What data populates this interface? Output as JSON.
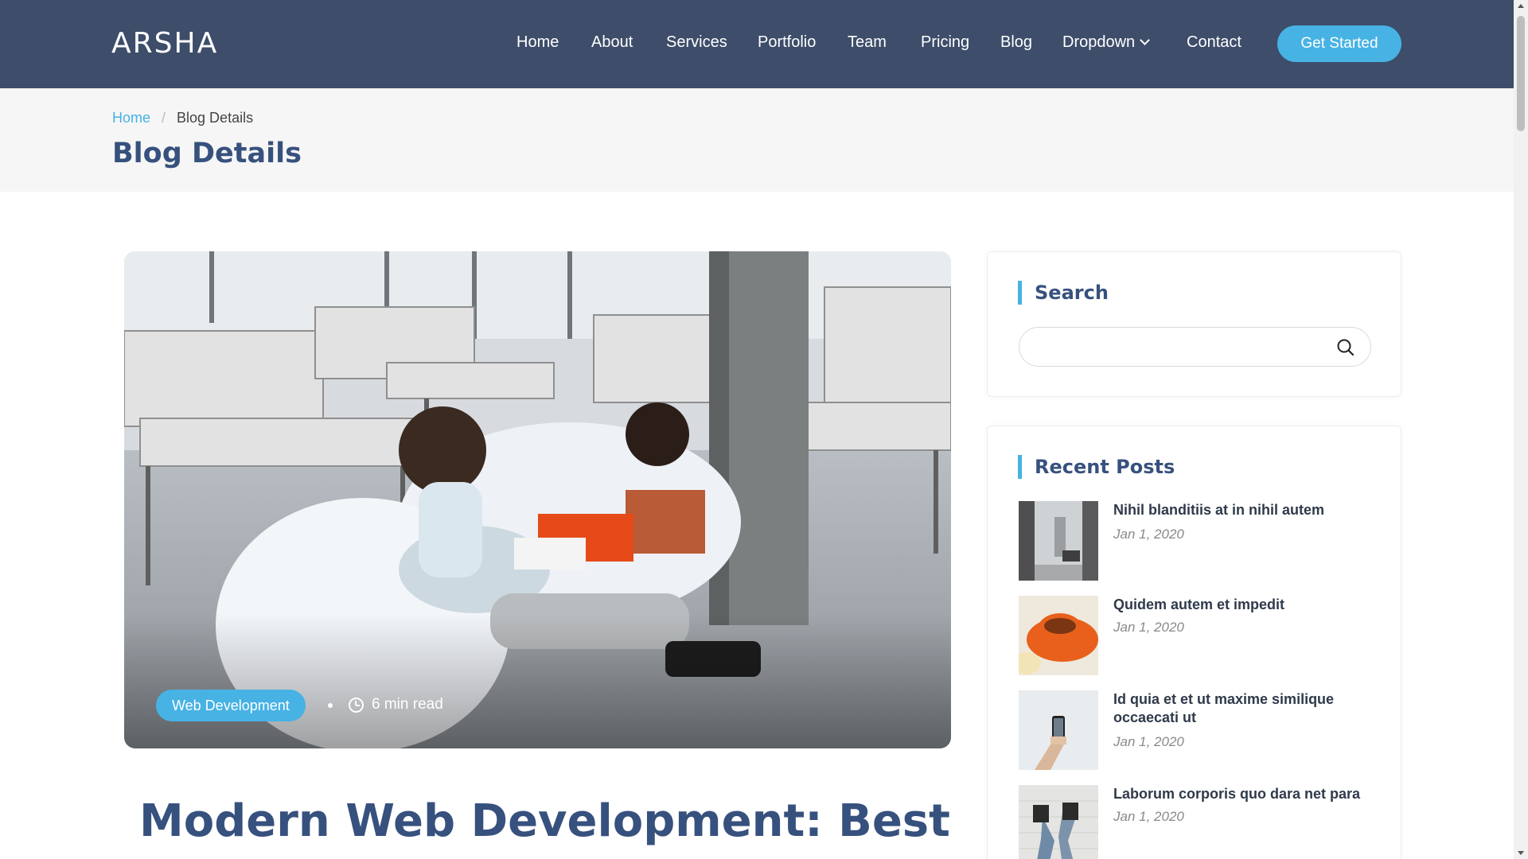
{
  "header": {
    "logo": "ARSHA",
    "nav": [
      "Home",
      "About",
      "Services",
      "Portfolio",
      "Team",
      "Pricing",
      "Blog",
      "Dropdown",
      "Contact"
    ],
    "cta": "Get Started"
  },
  "page": {
    "breadcrumb_home": "Home",
    "breadcrumb_sep": "/",
    "breadcrumb_current": "Blog Details",
    "title": "Blog Details"
  },
  "post": {
    "category": "Web Development",
    "read_time": "6 min read",
    "title": "Modern Web Development: Best"
  },
  "sidebar": {
    "search_title": "Search",
    "search_value": "",
    "recent_title": "Recent Posts",
    "recent_posts": [
      {
        "title": "Nihil blanditiis at in nihil autem",
        "date": "Jan 1, 2020"
      },
      {
        "title": "Quidem autem et impedit",
        "date": "Jan 1, 2020"
      },
      {
        "title": "Id quia et et ut maxime similique occaecati ut",
        "date": "Jan 1, 2020"
      },
      {
        "title": "Laborum corporis quo dara net para",
        "date": "Jan 1, 2020"
      }
    ]
  },
  "colors": {
    "header_bg": "#3d4d6a",
    "accent": "#47b2e4",
    "heading": "#37517e"
  },
  "icons": {
    "search": "search-icon",
    "clock": "clock-icon",
    "dropdown": "chevron-down-icon"
  }
}
